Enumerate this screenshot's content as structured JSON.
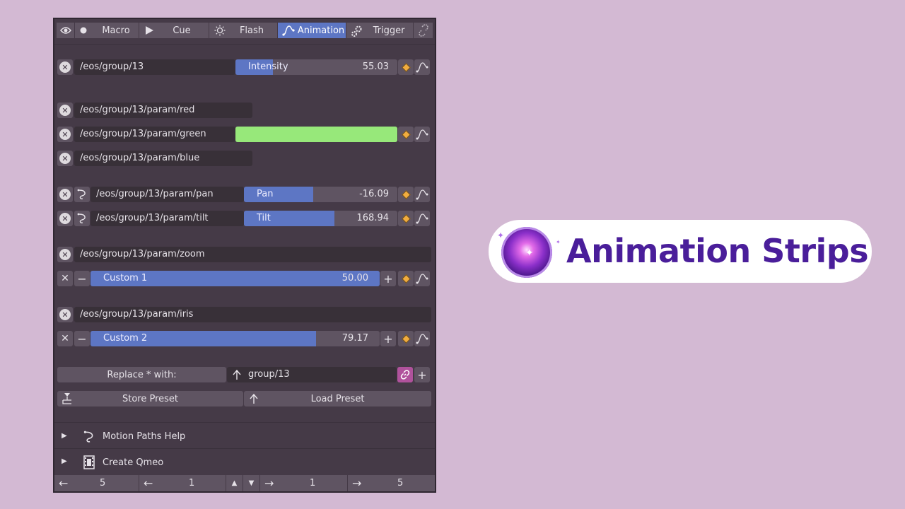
{
  "tabs": [
    {
      "label": "",
      "icon": "eye-icon"
    },
    {
      "label": "Macro",
      "icon": "dot-icon"
    },
    {
      "label": "Cue",
      "icon": "play-icon"
    },
    {
      "label": "Flash",
      "icon": "sun-icon"
    },
    {
      "label": "Animation",
      "icon": "curve-icon",
      "active": true
    },
    {
      "label": "Trigger",
      "icon": "gears-icon"
    },
    {
      "label": "",
      "icon": "broken-link-icon"
    }
  ],
  "rows": {
    "intensity": {
      "path": "/eos/group/13",
      "label": "Intensity",
      "value": "55.03",
      "fill": 0.23
    },
    "red": {
      "path": "/eos/group/13/param/red"
    },
    "green": {
      "path": "/eos/group/13/param/green",
      "color": "#97e87a"
    },
    "blue": {
      "path": "/eos/group/13/param/blue"
    },
    "pan": {
      "path": "/eos/group/13/param/pan",
      "label": "Pan",
      "value": "-16.09",
      "fill": 0.45
    },
    "tilt": {
      "path": "/eos/group/13/param/tilt",
      "label": "Tilt",
      "value": "168.94",
      "fill": 0.59
    },
    "zoom": {
      "path": "/eos/group/13/param/zoom"
    },
    "custom1": {
      "label": "Custom 1",
      "value": "50.00",
      "fill": 1.0
    },
    "iris": {
      "path": "/eos/group/13/param/iris"
    },
    "custom2": {
      "label": "Custom 2",
      "value": "79.17",
      "fill": 0.78
    }
  },
  "replace": {
    "label": "Replace * with:",
    "value": "group/13"
  },
  "presets": {
    "store": "Store Preset",
    "load": "Load Preset"
  },
  "sections": {
    "motion_paths": "Motion Paths Help",
    "create_qmeo": "Create Qmeo"
  },
  "footer": {
    "a": "5",
    "b": "1",
    "c": "1",
    "d": "5"
  },
  "badge": {
    "title": "Animation Strips"
  },
  "colors": {
    "accent": "#5d76c4",
    "panel": "#453a47",
    "green": "#97e87a",
    "keyframe": "#f0ac3f",
    "title": "#4a1e9a"
  }
}
